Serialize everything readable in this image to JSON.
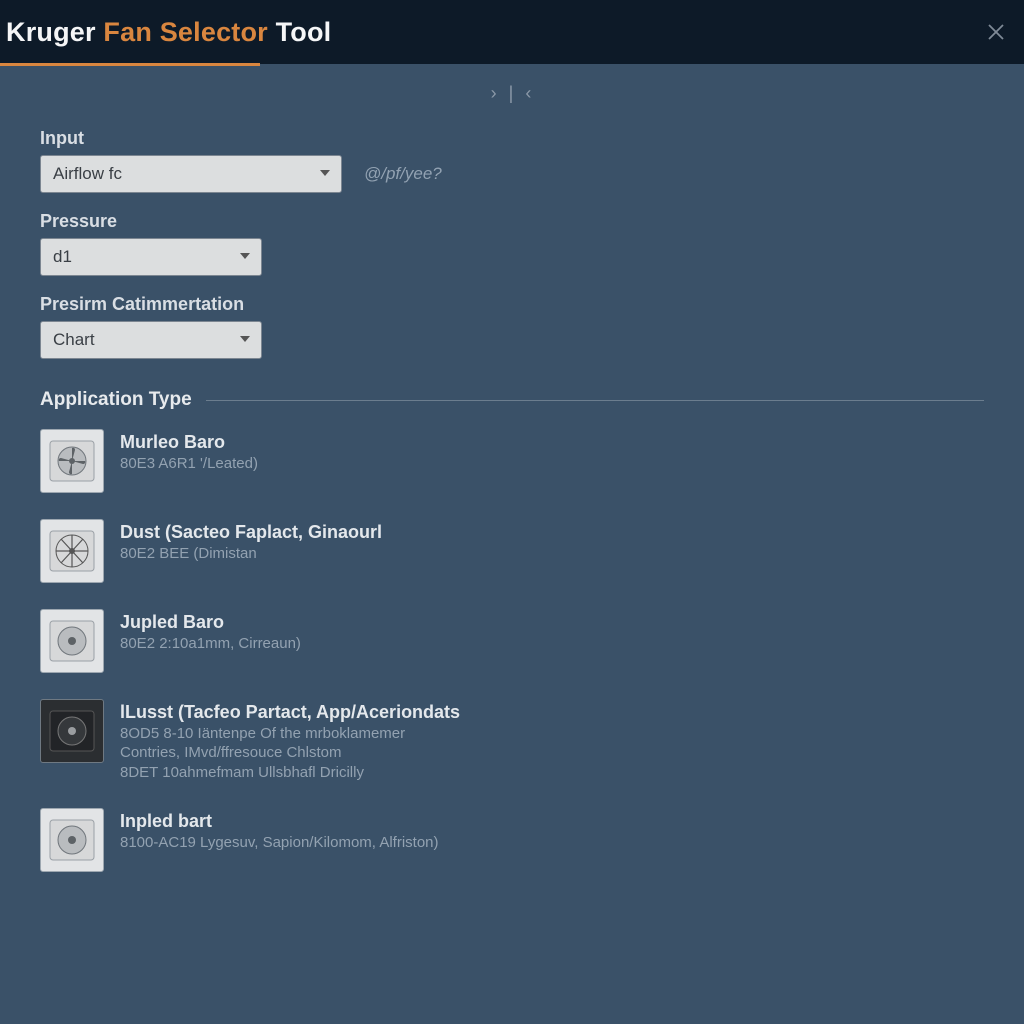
{
  "header": {
    "title_pre": "Kruger ",
    "title_accent": "Fan Selector",
    "title_post": " Tool"
  },
  "pager": {
    "prev": "›",
    "sep": "|",
    "next": "‹"
  },
  "form": {
    "input": {
      "label": "Input",
      "value": "Airflow fc",
      "hint": "@/pf/yee?"
    },
    "pressure": {
      "label": "Pressure",
      "value": "d1"
    },
    "presentation": {
      "label": "Presirm Catimmertation",
      "value": "Chart"
    }
  },
  "sections": {
    "application": {
      "title": "Application Type",
      "items": [
        {
          "thumb": "light",
          "title": "Murleo Baro",
          "sub": "80E3 A6R1 '/Leated)"
        },
        {
          "thumb": "light",
          "title": "Dust (Sacteo Faplact, Ginaourl",
          "sub": "80E2 BEE (Dimistan"
        },
        {
          "thumb": "light",
          "title": "Jupled Baro",
          "sub": "80E2 2:10a1mm, Cirreaun)"
        },
        {
          "thumb": "dark",
          "title": "lLusst (Tacfeo Partact, App/Aceriondats",
          "sub": "8OD5 8-10 Iäntenpe Of the mrboklamemer\nContries, IMvd/ffresouce Chlstom\n8DET 10ahmefmam Ullsbhafl Dricilly"
        },
        {
          "thumb": "light",
          "title": "Inpled bart",
          "sub": "8100-AC19 Lygesuv, Sapion/Kilomom, Alfriston)"
        }
      ]
    }
  }
}
